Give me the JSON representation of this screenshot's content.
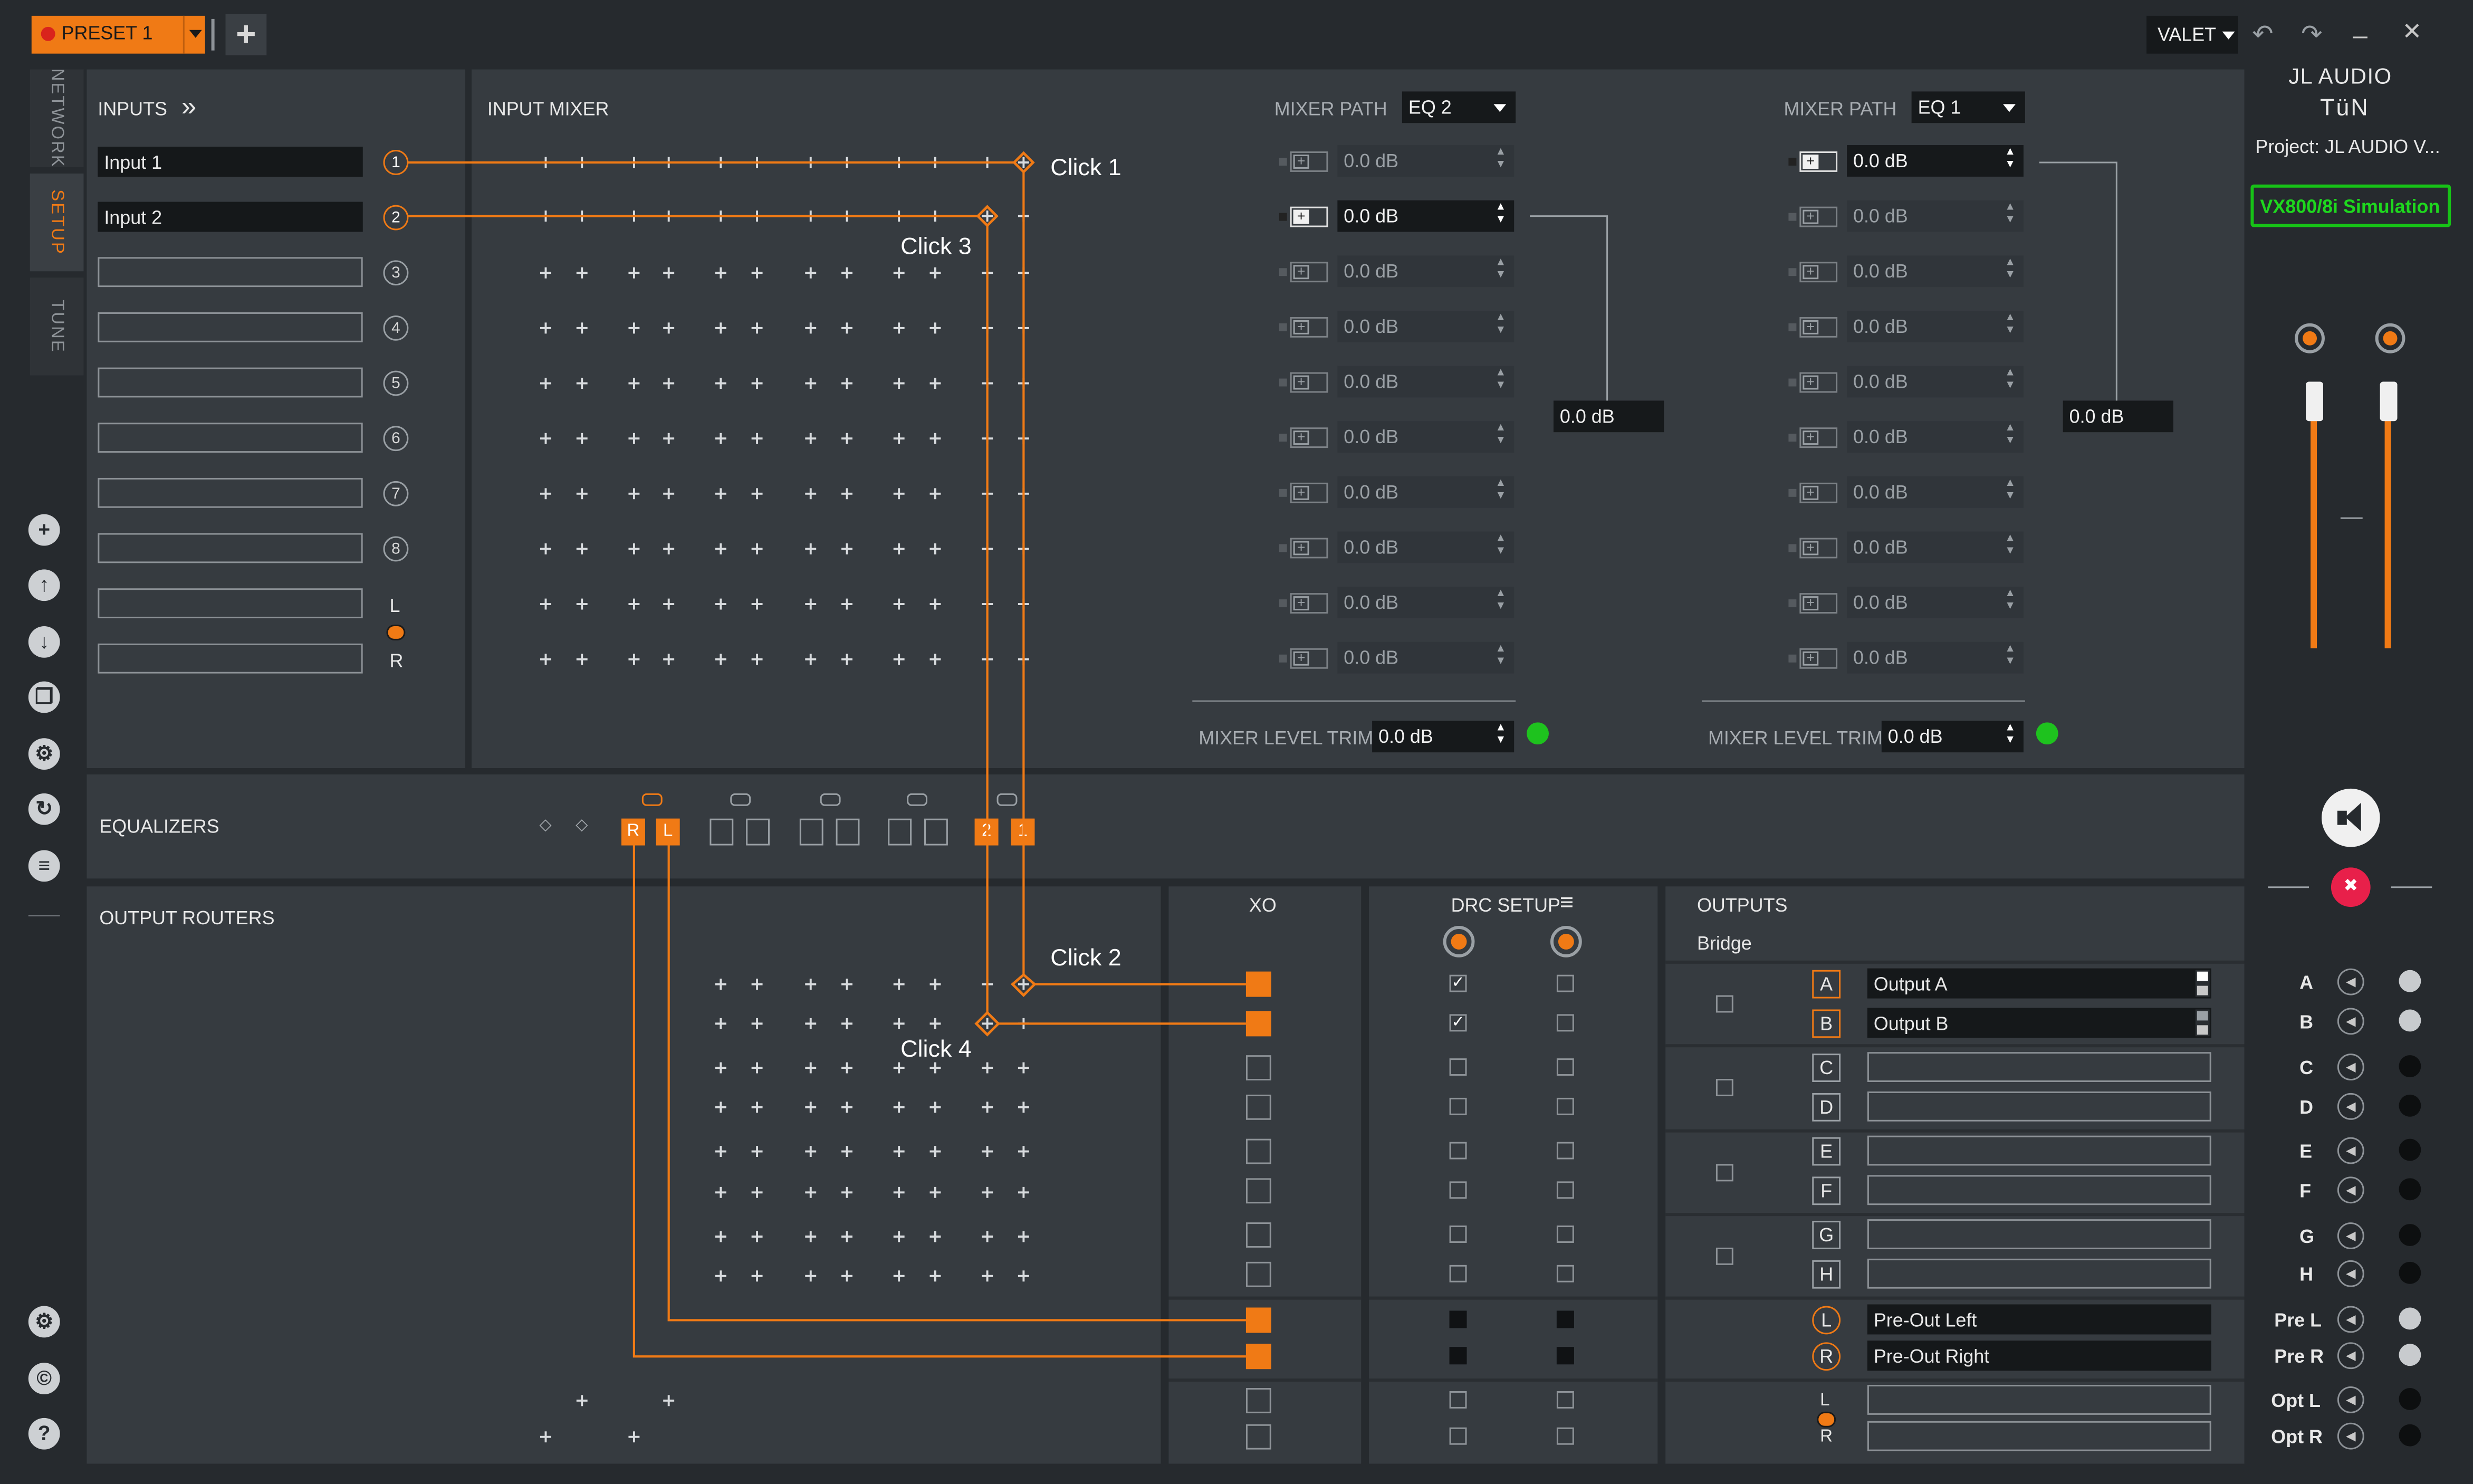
{
  "titlebar": {
    "preset_label": "PRESET 1",
    "add_symbol": "+",
    "user_label": "VALET",
    "minimize_symbol": "_",
    "close_symbol": "✕"
  },
  "side_tabs": [
    "NETWORK",
    "SETUP",
    "TUNE"
  ],
  "inputs": {
    "title": "INPUTS",
    "expand_symbol": "»",
    "rows": [
      {
        "value": "Input 1",
        "num": "1"
      },
      {
        "value": "Input 2",
        "num": "2"
      },
      {
        "value": "",
        "num": "3"
      },
      {
        "value": "",
        "num": "4"
      },
      {
        "value": "",
        "num": "5"
      },
      {
        "value": "",
        "num": "6"
      },
      {
        "value": "",
        "num": "7"
      },
      {
        "value": "",
        "num": "8"
      },
      {
        "value": "",
        "num": "L"
      },
      {
        "value": "",
        "num": "R"
      }
    ]
  },
  "input_mixer": {
    "title": "INPUT MIXER",
    "click_labels": [
      "Click 1",
      "Click 3"
    ],
    "paths": [
      {
        "path_label": "MIXER PATH",
        "eq": "EQ 2",
        "levels": [
          "0.0 dB",
          "0.0 dB",
          "0.0 dB",
          "0.0 dB",
          "0.0 dB",
          "0.0 dB",
          "0.0 dB",
          "0.0 dB",
          "0.0 dB",
          "0.0 dB"
        ],
        "active_index": 1,
        "sum_level": "0.0 dB",
        "trim_label": "MIXER LEVEL TRIM",
        "trim_value": "0.0 dB"
      },
      {
        "path_label": "MIXER PATH",
        "eq": "EQ 1",
        "levels": [
          "0.0 dB",
          "0.0 dB",
          "0.0 dB",
          "0.0 dB",
          "0.0 dB",
          "0.0 dB",
          "0.0 dB",
          "0.0 dB",
          "0.0 dB",
          "0.0 dB"
        ],
        "active_index": 0,
        "sum_level": "0.0 dB",
        "trim_label": "MIXER LEVEL TRIM",
        "trim_value": "0.0 dB"
      }
    ]
  },
  "equalizers": {
    "title": "EQUALIZERS",
    "active_labels": [
      "R",
      "L",
      "2",
      "1"
    ]
  },
  "output_routers": {
    "title": "OUTPUT ROUTERS",
    "click_labels": [
      "Click 2",
      "Click 4"
    ]
  },
  "xo": {
    "title": "XO"
  },
  "drc": {
    "title": "DRC SETUP"
  },
  "outputs": {
    "title": "OUTPUTS",
    "bridge_label": "Bridge",
    "channels": [
      {
        "id": "A",
        "name": "Output A"
      },
      {
        "id": "B",
        "name": "Output B"
      },
      {
        "id": "C",
        "name": ""
      },
      {
        "id": "D",
        "name": ""
      },
      {
        "id": "E",
        "name": ""
      },
      {
        "id": "F",
        "name": ""
      },
      {
        "id": "G",
        "name": ""
      },
      {
        "id": "H",
        "name": ""
      },
      {
        "id": "L",
        "name": "Pre-Out Left"
      },
      {
        "id": "R",
        "name": "Pre-Out Right"
      },
      {
        "id": "L",
        "name": ""
      },
      {
        "id": "R",
        "name": ""
      }
    ]
  },
  "right_panel": {
    "brand_line1": "JL AUDIO",
    "brand_line2": "TüN",
    "project": "Project: JL AUDIO V...",
    "device": "VX800/8i Simulation",
    "meters": [
      {
        "id": "A",
        "led": "#c8cbce"
      },
      {
        "id": "B",
        "led": "#c8cbce"
      },
      {
        "id": "C",
        "led": "#0d0f10"
      },
      {
        "id": "D",
        "led": "#0d0f10"
      },
      {
        "id": "E",
        "led": "#0d0f10"
      },
      {
        "id": "F",
        "led": "#0d0f10"
      },
      {
        "id": "G",
        "led": "#0d0f10"
      },
      {
        "id": "H",
        "led": "#0d0f10"
      },
      {
        "id": "Pre L",
        "led": "#c8cbce"
      },
      {
        "id": "Pre R",
        "led": "#c8cbce"
      },
      {
        "id": "Opt L",
        "led": "#0d0f10"
      },
      {
        "id": "Opt R",
        "led": "#0d0f10"
      }
    ]
  },
  "colors": {
    "accent": "#f07a15",
    "status_green": "#1ec21e",
    "mute_red": "#e8204a"
  },
  "icons": [
    "add-icon",
    "upload-icon",
    "download-icon",
    "copy-icon",
    "wrench-icon",
    "restore-icon",
    "list-icon",
    "gear-icon",
    "copyright-icon",
    "help-icon"
  ]
}
